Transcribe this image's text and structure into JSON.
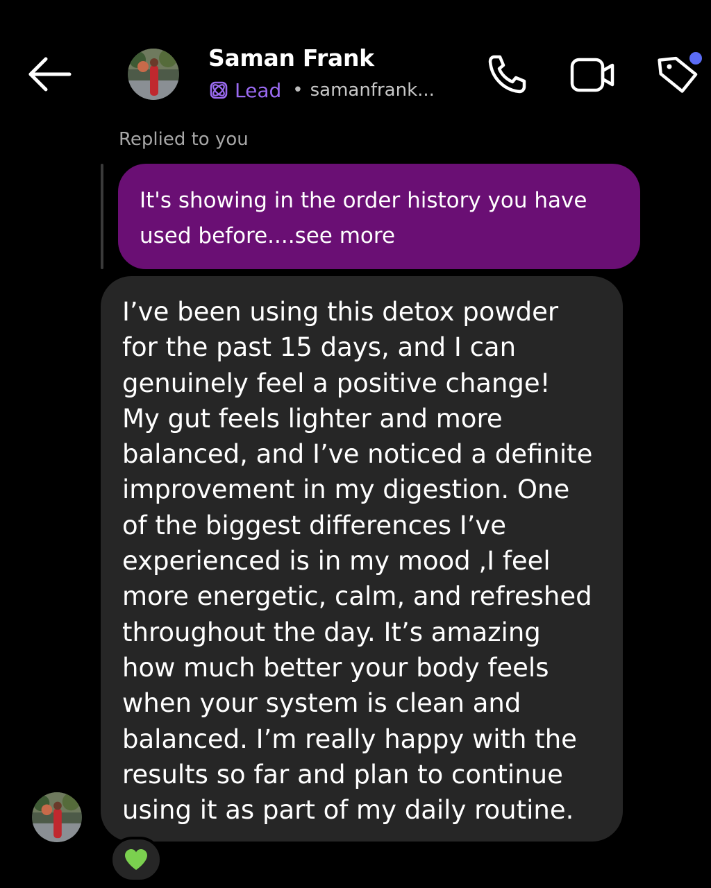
{
  "header": {
    "contact_name": "Saman Frank",
    "status_label": "Lead",
    "separator": "•",
    "username": "samanfrank...",
    "icons": {
      "back": "arrow-left-icon",
      "avatar": "avatar-photo",
      "lead": "lead-atom-icon",
      "call": "phone-icon",
      "video": "video-camera-icon",
      "label": "tag-icon"
    }
  },
  "reply_context": {
    "label": "Replied to you",
    "quoted_text_line1": "It's showing in the order history you have",
    "quoted_text_line2": "used before....see more"
  },
  "message": {
    "lines": [
      "I’ve been using this detox powder",
      "for the past 15 days, and I can",
      "genuinely feel a positive change!",
      "My gut feels lighter and more",
      "balanced, and I’ve noticed a definite",
      "improvement in my digestion. One",
      "of the biggest differences I’ve",
      "experienced is in my mood ,I feel",
      "more energetic, calm, and refreshed",
      "throughout the day. It’s amazing",
      "how much better your body feels",
      "when your system is clean and",
      "balanced. I’m really happy with the",
      "results so far and plan to continue",
      "using it as part of my daily routine."
    ],
    "reaction": "💚"
  },
  "colors": {
    "background": "#000000",
    "accent_lead": "#9b6bf2",
    "reply_bubble": "#6a0f74",
    "received_bubble": "#262626",
    "notification_dot": "#5b6cf5",
    "reaction_heart": "#7bd04f"
  }
}
